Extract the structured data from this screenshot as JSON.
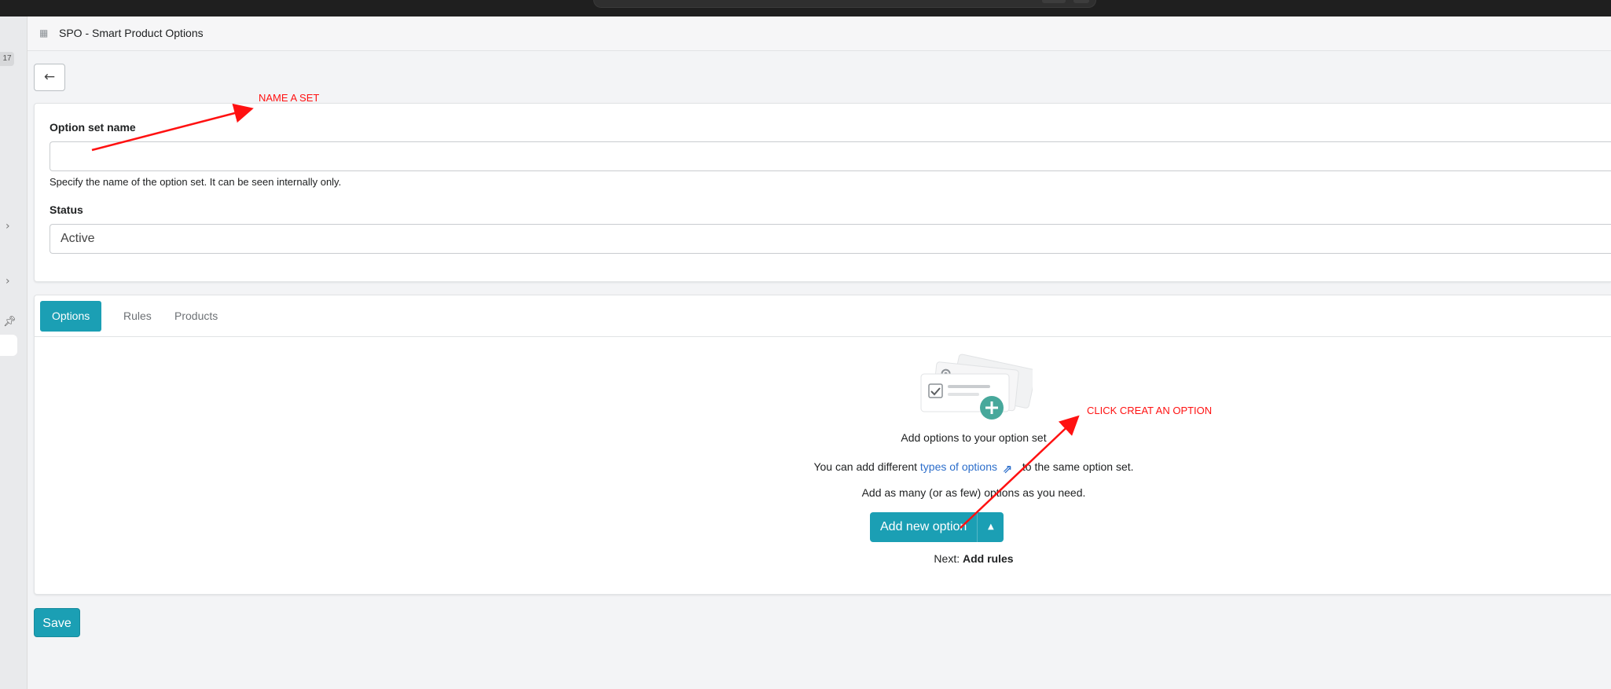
{
  "app": {
    "title": "SPO - Smart Product Options",
    "rail_badge": "17"
  },
  "form": {
    "option_set_name_label": "Option set name",
    "option_set_name_value": "",
    "option_set_name_help": "Specify the name of the option set. It can be seen internally only.",
    "status_label": "Status",
    "status_value": "Active"
  },
  "tabs": [
    {
      "label": "Options",
      "active": true
    },
    {
      "label": "Rules",
      "active": false
    },
    {
      "label": "Products",
      "active": false
    }
  ],
  "empty_state": {
    "title": "Add options to your option set",
    "line2_prefix": "You can add different ",
    "line2_link": "types of options",
    "line2_suffix": " to the same option set.",
    "line3": "Add as many (or as few) options as you need.",
    "add_button": "Add new option",
    "next_prefix": "Next: ",
    "next_bold": "Add rules"
  },
  "save_label": "Save",
  "annotations": {
    "name_a_set": "NAME A SET",
    "click_create": "CLICK CREAT AN OPTION"
  },
  "colors": {
    "accent": "#1b9fb4",
    "link": "#2c6ecb",
    "annotation": "#ff1111"
  }
}
